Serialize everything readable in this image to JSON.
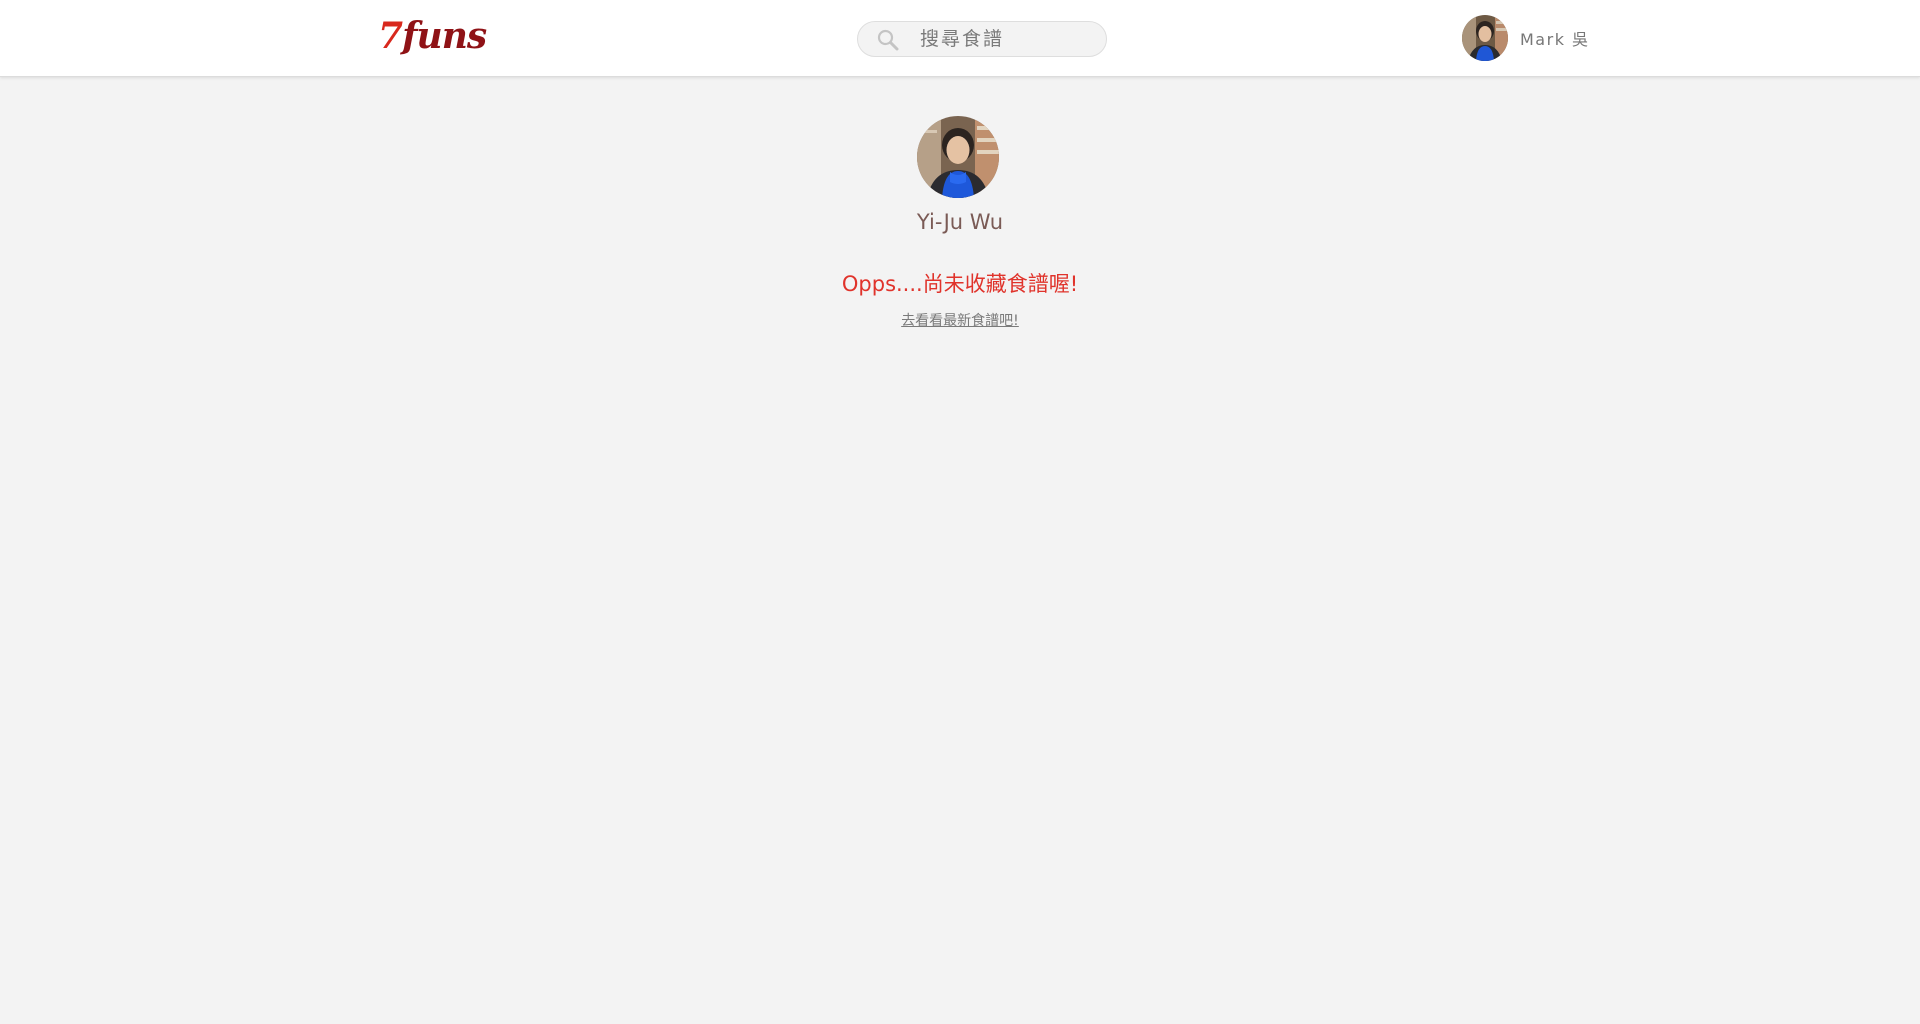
{
  "header": {
    "logo": {
      "seven": "7",
      "rest": "funs"
    },
    "search": {
      "placeholder": "搜尋食譜",
      "value": ""
    },
    "user": {
      "name": "Mark 吳"
    }
  },
  "profile": {
    "name": "Yi-Ju Wu"
  },
  "empty_state": {
    "message": "Opps....尚未收藏食譜喔!",
    "link": "去看看最新食譜吧!"
  },
  "colors": {
    "logo_dark": "#8f1216",
    "logo_accent": "#d8281d",
    "message_red": "#e0332b",
    "background": "#f3f3f3"
  },
  "icons": {
    "search": "search-icon"
  }
}
